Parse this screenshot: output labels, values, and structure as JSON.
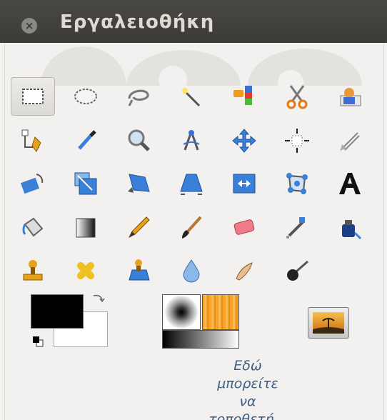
{
  "window": {
    "title": "Εργαλειοθήκη",
    "close_glyph": "×"
  },
  "tools": [
    [
      {
        "name": "rect-select-icon",
        "active": true
      },
      {
        "name": "ellipse-select-icon"
      },
      {
        "name": "free-select-icon"
      },
      {
        "name": "fuzzy-select-icon"
      },
      {
        "name": "select-by-color-icon"
      },
      {
        "name": "scissors-select-icon"
      },
      {
        "name": "foreground-select-icon"
      }
    ],
    [
      {
        "name": "paths-icon"
      },
      {
        "name": "color-picker-icon"
      },
      {
        "name": "zoom-icon"
      },
      {
        "name": "measure-icon"
      },
      {
        "name": "move-icon"
      },
      {
        "name": "align-icon"
      },
      {
        "name": "crop-icon"
      }
    ],
    [
      {
        "name": "rotate-icon"
      },
      {
        "name": "scale-icon"
      },
      {
        "name": "shear-icon"
      },
      {
        "name": "perspective-icon"
      },
      {
        "name": "flip-icon"
      },
      {
        "name": "cage-transform-icon"
      },
      {
        "name": "text-icon"
      }
    ],
    [
      {
        "name": "bucket-fill-icon"
      },
      {
        "name": "blend-icon"
      },
      {
        "name": "pencil-icon"
      },
      {
        "name": "paintbrush-icon"
      },
      {
        "name": "eraser-icon"
      },
      {
        "name": "airbrush-icon"
      },
      {
        "name": "ink-icon"
      }
    ],
    [
      {
        "name": "clone-icon"
      },
      {
        "name": "heal-icon"
      },
      {
        "name": "perspective-clone-icon"
      },
      {
        "name": "blur-sharpen-icon"
      },
      {
        "name": "smudge-icon"
      },
      {
        "name": "dodge-burn-icon"
      }
    ]
  ],
  "colors": {
    "foreground": "#000000",
    "background": "#ffffff"
  },
  "hint_text": [
    "Εδώ",
    "μπορείτε",
    "να",
    "τοποθετή..."
  ]
}
